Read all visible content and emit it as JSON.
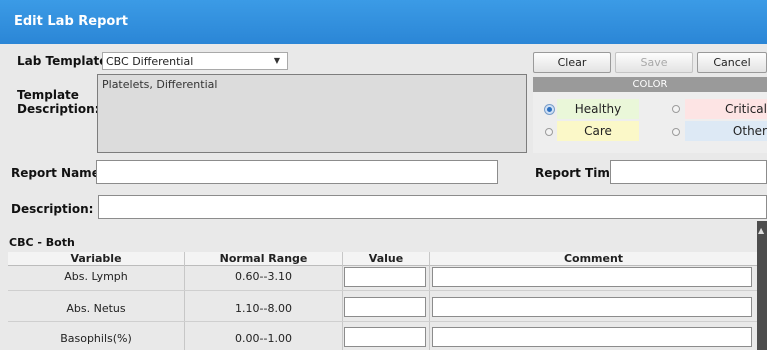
{
  "dialog": {
    "title": "Edit Lab Report"
  },
  "form": {
    "lab_template_label": "Lab Template:",
    "lab_template_value": "CBC Differential",
    "template_description_label_1": "Template",
    "template_description_label_2": "Description:",
    "template_description_value": "Platelets, Differential",
    "report_name_label": "Report Name:",
    "report_time_label": "Report Time:",
    "description_label": "Description:"
  },
  "buttons": {
    "clear": "Clear",
    "save": "Save",
    "cancel": "Cancel"
  },
  "color": {
    "header": "COLOR",
    "options": [
      {
        "label": "Healthy",
        "bg": "#eaf7d9",
        "selected": true
      },
      {
        "label": "Critical",
        "bg": "#fde4e4",
        "selected": false
      },
      {
        "label": "Care",
        "bg": "#fbf8c8",
        "selected": false
      },
      {
        "label": "Other",
        "bg": "#dde9f5",
        "selected": false
      }
    ]
  },
  "section": {
    "title": "CBC - Both"
  },
  "table": {
    "headers": [
      "Variable",
      "Normal Range",
      "Value",
      "Comment"
    ],
    "rows": [
      {
        "variable": "Abs. Lymph",
        "range": "0.60--3.10"
      },
      {
        "variable": "Abs. Netus",
        "range": "1.10--8.00"
      },
      {
        "variable": "Basophils(%)",
        "range": "0.00--1.00"
      }
    ]
  },
  "colors": {
    "title_bar": "#2b86d6",
    "window_bg": "#e9e9e9"
  }
}
